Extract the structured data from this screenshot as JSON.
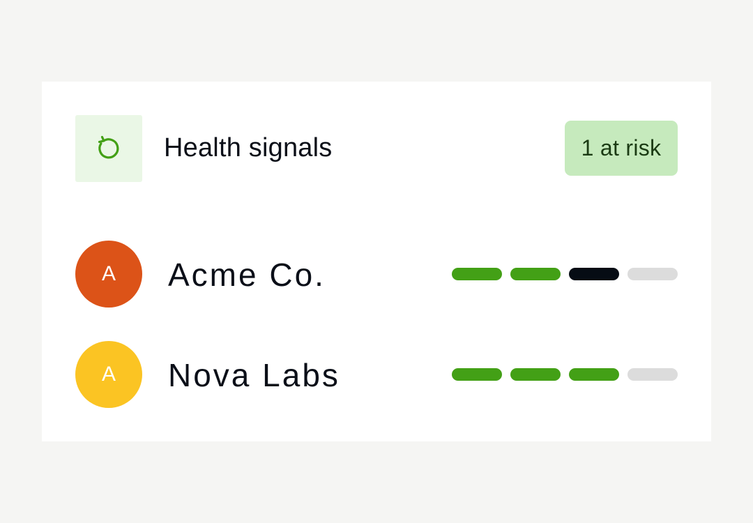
{
  "header": {
    "title": "Health signals",
    "icon": "refresh-icon",
    "badge": "1 at risk"
  },
  "rows": [
    {
      "name": "Acme Co.",
      "initial": "A",
      "avatar_color": "#dc5318",
      "signals": [
        "good",
        "good",
        "risk",
        "empty"
      ]
    },
    {
      "name": "Nova Labs",
      "initial": "A",
      "avatar_color": "#fbc423",
      "signals": [
        "good",
        "good",
        "good",
        "empty"
      ]
    }
  ],
  "colors": {
    "good": "#43a016",
    "risk": "#060c14",
    "empty": "#dcdcdc",
    "icon": "#43a016",
    "badge_bg": "#c6eabd"
  }
}
